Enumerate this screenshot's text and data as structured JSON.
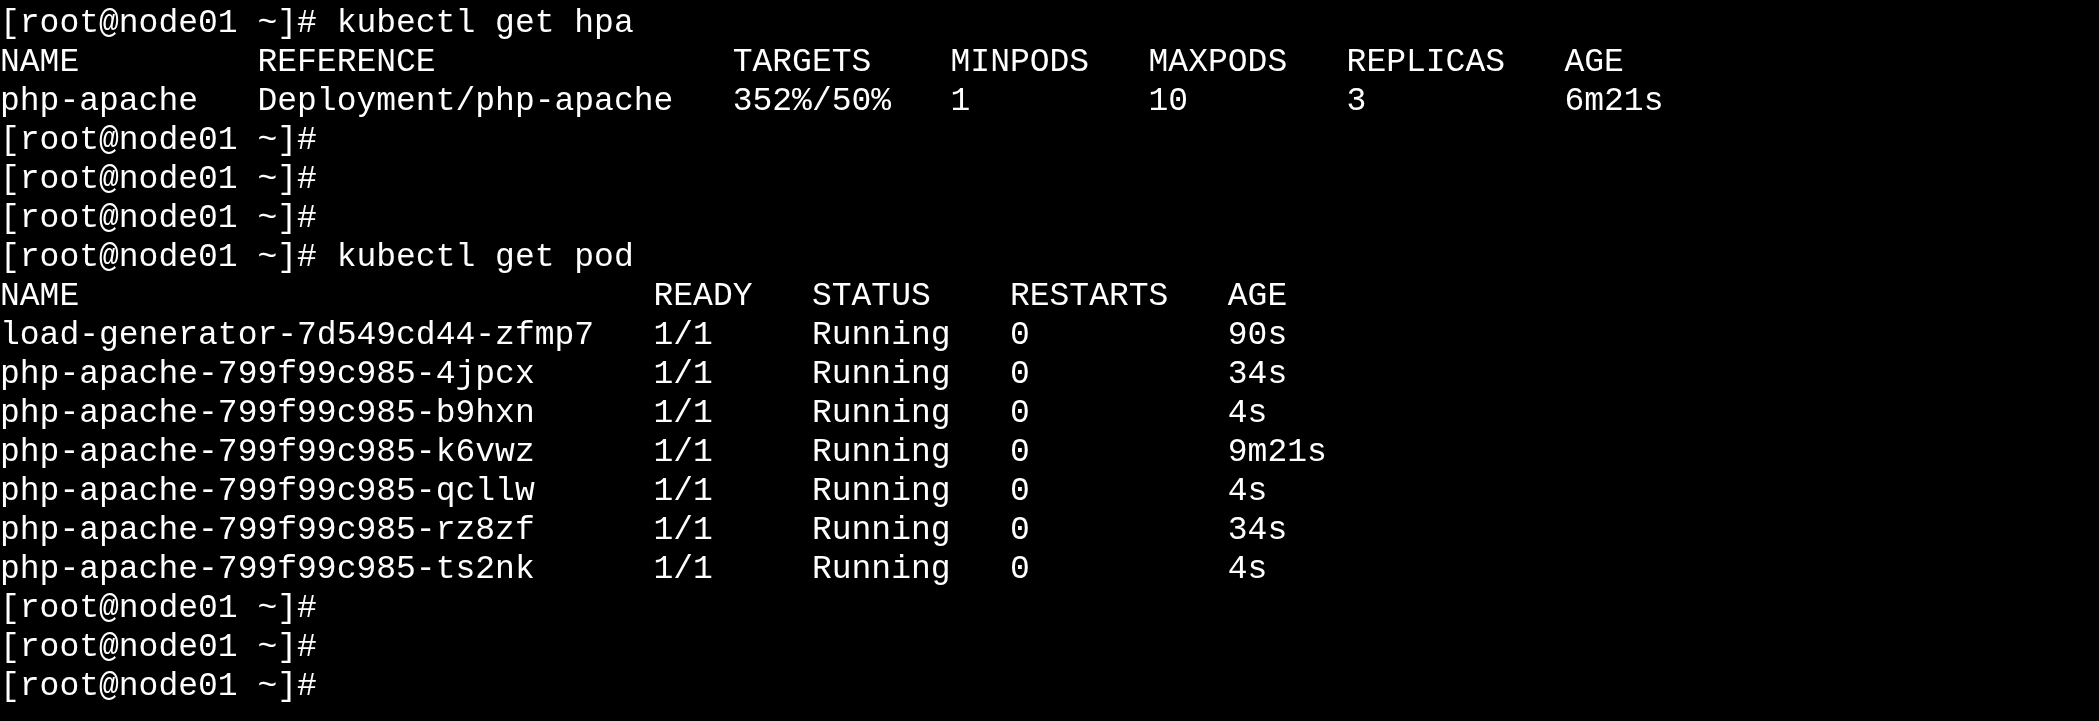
{
  "terminal": {
    "blocks": [
      {
        "kind": "prompt",
        "prompt": "[root@node01 ~]#",
        "command": "kubectl get hpa"
      },
      {
        "kind": "table",
        "columns": [
          "NAME",
          "REFERENCE",
          "TARGETS",
          "MINPODS",
          "MAXPODS",
          "REPLICAS",
          "AGE"
        ],
        "rows": [
          [
            "php-apache",
            "Deployment/php-apache",
            "352%/50%",
            "1",
            "10",
            "3",
            "6m21s"
          ]
        ]
      },
      {
        "kind": "prompt",
        "prompt": "[root@node01 ~]#"
      },
      {
        "kind": "prompt",
        "prompt": "[root@node01 ~]#"
      },
      {
        "kind": "prompt",
        "prompt": "[root@node01 ~]#"
      },
      {
        "kind": "prompt",
        "prompt": "[root@node01 ~]#",
        "command": "kubectl get pod"
      },
      {
        "kind": "table",
        "columns": [
          "NAME",
          "READY",
          "STATUS",
          "RESTARTS",
          "AGE"
        ],
        "rows": [
          [
            "load-generator-7d549cd44-zfmp7",
            "1/1",
            "Running",
            "0",
            "90s"
          ],
          [
            "php-apache-799f99c985-4jpcx",
            "1/1",
            "Running",
            "0",
            "34s"
          ],
          [
            "php-apache-799f99c985-b9hxn",
            "1/1",
            "Running",
            "0",
            "4s"
          ],
          [
            "php-apache-799f99c985-k6vwz",
            "1/1",
            "Running",
            "0",
            "9m21s"
          ],
          [
            "php-apache-799f99c985-qcllw",
            "1/1",
            "Running",
            "0",
            "4s"
          ],
          [
            "php-apache-799f99c985-rz8zf",
            "1/1",
            "Running",
            "0",
            "34s"
          ],
          [
            "php-apache-799f99c985-ts2nk",
            "1/1",
            "Running",
            "0",
            "4s"
          ]
        ]
      },
      {
        "kind": "prompt",
        "prompt": "[root@node01 ~]#"
      },
      {
        "kind": "prompt",
        "prompt": "[root@node01 ~]#"
      },
      {
        "kind": "prompt",
        "prompt": "[root@node01 ~]#"
      }
    ]
  }
}
